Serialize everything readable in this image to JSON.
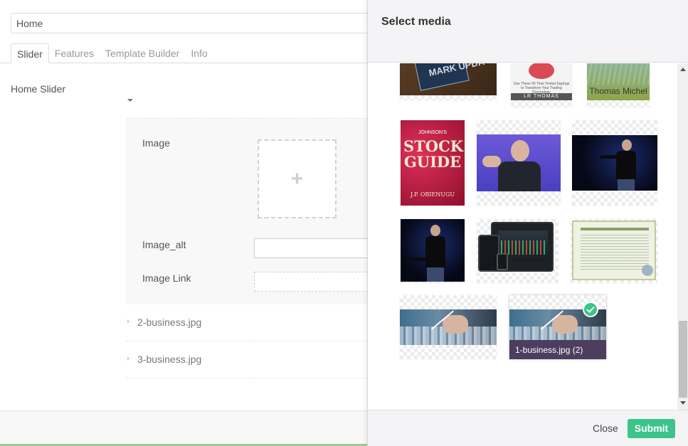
{
  "editor": {
    "title_value": "Home",
    "tabs": [
      {
        "label": "Slider"
      },
      {
        "label": "Features"
      },
      {
        "label": "Template Builder"
      },
      {
        "label": "Info"
      }
    ],
    "section_label": "Home Slider",
    "fields": {
      "image_label": "Image",
      "image_alt_label": "Image_alt",
      "image_link_label": "Image Link"
    },
    "slides": [
      {
        "label": "2-business.jpg"
      },
      {
        "label": "3-business.jpg"
      }
    ]
  },
  "modal": {
    "title": "Select media",
    "close_label": "Close",
    "submit_label": "Submit",
    "selected_caption": "1-business.jpg (2)",
    "thumb_text": {
      "book1": "MARK UPDA",
      "book2_subtitle": "Use These 55 Time Tested Sayings to Transform Your Trading Psychology",
      "book2_author": "LR THOMAS",
      "book3_author": "Thomas Michel",
      "stock_top": "JOHNSON'S",
      "stock_title": "STOCK GUIDE",
      "stock_author": "J.P. OBIENUGU"
    }
  },
  "colors": {
    "accent": "#3cc48a",
    "caption_bg": "#4d3d5e"
  }
}
